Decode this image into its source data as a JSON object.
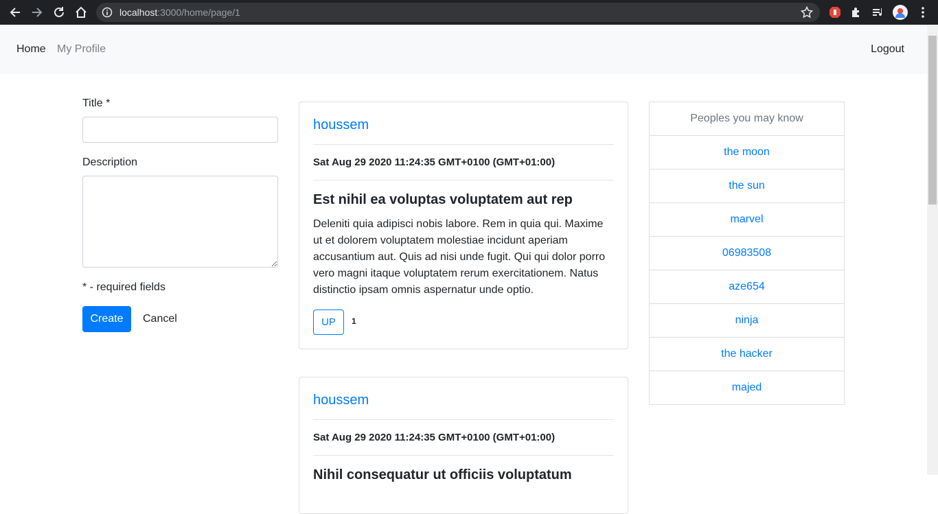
{
  "browser": {
    "url_host": "localhost",
    "url_rest": ":3000/home/page/1"
  },
  "navbar": {
    "home": "Home",
    "profile": "My Profile",
    "logout": "Logout"
  },
  "form": {
    "title_label": "Title *",
    "title_value": "",
    "description_label": "Description",
    "description_value": "",
    "required_note": "* - required fields",
    "create_label": "Create",
    "cancel_label": "Cancel"
  },
  "posts": [
    {
      "author": "houssem",
      "date": "Sat Aug 29 2020 11:24:35 GMT+0100 (GMT+01:00)",
      "title": "Est nihil ea voluptas voluptatem aut rep",
      "body": "Deleniti quia adipisci nobis labore. Rem in quia qui. Maxime ut et dolorem voluptatem molestiae incidunt aperiam accusantium aut. Quis ad nisi unde fugit. Qui qui dolor porro vero magni itaque voluptatem rerum exercitationem. Natus distinctio ipsam omnis aspernatur unde optio.",
      "up_label": "UP",
      "up_count": "1"
    },
    {
      "author": "houssem",
      "date": "Sat Aug 29 2020 11:24:35 GMT+0100 (GMT+01:00)",
      "title": "Nihil consequatur ut officiis voluptatum"
    }
  ],
  "people": {
    "header": "Peoples you may know",
    "items": [
      "the moon",
      "the sun",
      "marvel",
      "06983508",
      "aze654",
      "ninja",
      "the hacker",
      "majed"
    ]
  },
  "colors": {
    "primary": "#007bff",
    "navbar_bg": "#f8f9fa",
    "chrome_bg": "#202124"
  }
}
